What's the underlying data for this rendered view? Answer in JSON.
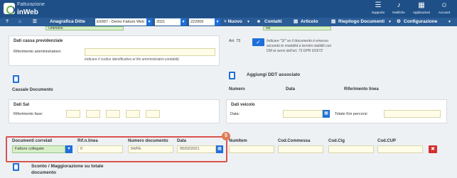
{
  "app": {
    "brand_top": "Fatturazione",
    "brand_bottom": "inWeb"
  },
  "top_icons": [
    {
      "label": "Supporto",
      "icon": "headset-icon",
      "glyph": "☰"
    },
    {
      "label": "Notifiche",
      "icon": "bell-icon",
      "glyph": "♪"
    },
    {
      "label": "Applicazioni",
      "icon": "apps-icon",
      "glyph": "▦"
    },
    {
      "label": "Account",
      "icon": "account-icon",
      "glyph": "☺"
    }
  ],
  "navbar": {
    "help": "?",
    "home_icon": "home-icon",
    "anagrafica_label": "Anagrafica Ditte",
    "ditta_value": "E6997 - Demo Fatture Web",
    "year_value": "2021",
    "code_value": "222909",
    "nuovo_label": "+ Nuovo",
    "contatti_label": "Contatti",
    "articolo_label": "Articolo",
    "riepilogo_label": "Riepilogo Documenti",
    "configurazione_label": "Configurazione"
  },
  "strip": {
    "left_value": "Ordinario",
    "right_value": "No"
  },
  "dati_cassa": {
    "title": "Dati cassa previdenziale",
    "riferimento_label": "Riferimento amministratore:",
    "hint": "Indicare il codice identificativo ai fini amministrativi-contabili)"
  },
  "art73": {
    "label": "Art. 73",
    "check_glyph": "✓",
    "hint": "Indicare \"SI\" se il documento è emesso secondo le modalità e termini stabiliti con DM ai sensi dell'art. 73 DPR 633/72"
  },
  "causale": {
    "label": "Causale Documento"
  },
  "ddt": {
    "title": "Aggiungi DDT associato",
    "col_numero": "Numero",
    "col_data": "Data",
    "col_riferimento": "Riferimento linea"
  },
  "dati_sal": {
    "title": "Dati Sal",
    "riferimento_fase_label": "Riferimento fase:"
  },
  "dati_veicolo": {
    "title": "Dati veicolo",
    "data_label": "Data:",
    "km_label": "Totale Km percorsi"
  },
  "correlati": {
    "col_documenti": "Documenti correlati",
    "col_rif_linea": "Rif.n.linea",
    "col_numero": "Numero documento",
    "col_data": "Data",
    "col_numitem": "NumItem",
    "col_commessa": "Cod.Commessa",
    "col_cig": "Cod.Cig",
    "col_cup": "Cod.CUP",
    "tipo_value": "Fatture collegate",
    "rif_value": "0",
    "numero_value": "54/FE",
    "data_value": "05/02/2021",
    "delete_glyph": "✖",
    "badge": "5"
  },
  "sconto": {
    "title_line1": "Sconto / Maggiorazione su totale",
    "title_line2": "documento"
  }
}
